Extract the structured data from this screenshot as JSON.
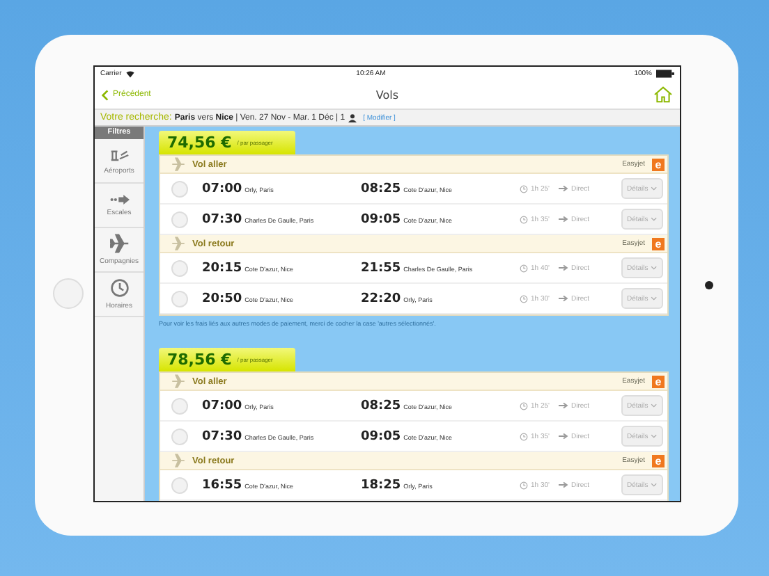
{
  "status_bar": {
    "carrier": "Carrier",
    "time": "10:26 AM",
    "battery": "100%"
  },
  "nav": {
    "back": "Précédent",
    "title": "Vols"
  },
  "search": {
    "label": "Votre recherche:",
    "summary": "**Paris** vers **Nice** | Ven. 27 Nov - Mar. 1 Déc | 1",
    "modify": "[ Modifier ]"
  },
  "sidebar": {
    "title": "Filtres",
    "items": [
      {
        "kind": "airports",
        "label": "Aéroports"
      },
      {
        "kind": "stops",
        "label": "Escales"
      },
      {
        "kind": "airlines",
        "label": "Compagnies"
      },
      {
        "kind": "hours",
        "label": "Horaires"
      }
    ]
  },
  "offers": [
    {
      "price": "74,56 €",
      "per": "/ par passager",
      "segments": [
        {
          "label": "Vol aller",
          "airline": "Easyjet",
          "logo_letter": "e",
          "flights": [
            {
              "selected": false,
              "dep_time": "07:00",
              "dep_place": "Orly, Paris",
              "arr_time": "08:25",
              "arr_place": "Cote D'azur, Nice",
              "duration": "1h 25'",
              "stops": "Direct",
              "details": "Détails"
            },
            {
              "selected": false,
              "dep_time": "07:30",
              "dep_place": "Charles De Gaulle, Paris",
              "arr_time": "09:05",
              "arr_place": "Cote D'azur, Nice",
              "duration": "1h 35'",
              "stops": "Direct",
              "details": "Détails"
            }
          ]
        },
        {
          "label": "Vol retour",
          "airline": "Easyjet",
          "logo_letter": "e",
          "flights": [
            {
              "selected": false,
              "dep_time": "20:15",
              "dep_place": "Cote D'azur, Nice",
              "arr_time": "21:55",
              "arr_place": "Charles De Gaulle, Paris",
              "duration": "1h 40'",
              "stops": "Direct",
              "details": "Détails"
            },
            {
              "selected": false,
              "dep_time": "20:50",
              "dep_place": "Cote D'azur, Nice",
              "arr_time": "22:20",
              "arr_place": "Orly, Paris",
              "duration": "1h 30'",
              "stops": "Direct",
              "details": "Détails"
            }
          ]
        }
      ],
      "note": "Pour voir les frais liés aux autres modes de paiement, merci de cocher la case 'autres sélectionnés'."
    },
    {
      "price": "78,56 €",
      "per": "/ par passager",
      "segments": [
        {
          "label": "Vol aller",
          "airline": "Easyjet",
          "logo_letter": "e",
          "flights": [
            {
              "selected": false,
              "dep_time": "07:00",
              "dep_place": "Orly, Paris",
              "arr_time": "08:25",
              "arr_place": "Cote D'azur, Nice",
              "duration": "1h 25'",
              "stops": "Direct",
              "details": "Détails"
            },
            {
              "selected": false,
              "dep_time": "07:30",
              "dep_place": "Charles De Gaulle, Paris",
              "arr_time": "09:05",
              "arr_place": "Cote D'azur, Nice",
              "duration": "1h 35'",
              "stops": "Direct",
              "details": "Détails"
            }
          ]
        },
        {
          "label": "Vol retour",
          "airline": "Easyjet",
          "logo_letter": "e",
          "flights": [
            {
              "selected": false,
              "dep_time": "16:55",
              "dep_place": "Cote D'azur, Nice",
              "arr_time": "18:25",
              "arr_place": "Orly, Paris",
              "duration": "1h 30'",
              "stops": "Direct",
              "details": "Détails"
            }
          ]
        }
      ]
    }
  ]
}
